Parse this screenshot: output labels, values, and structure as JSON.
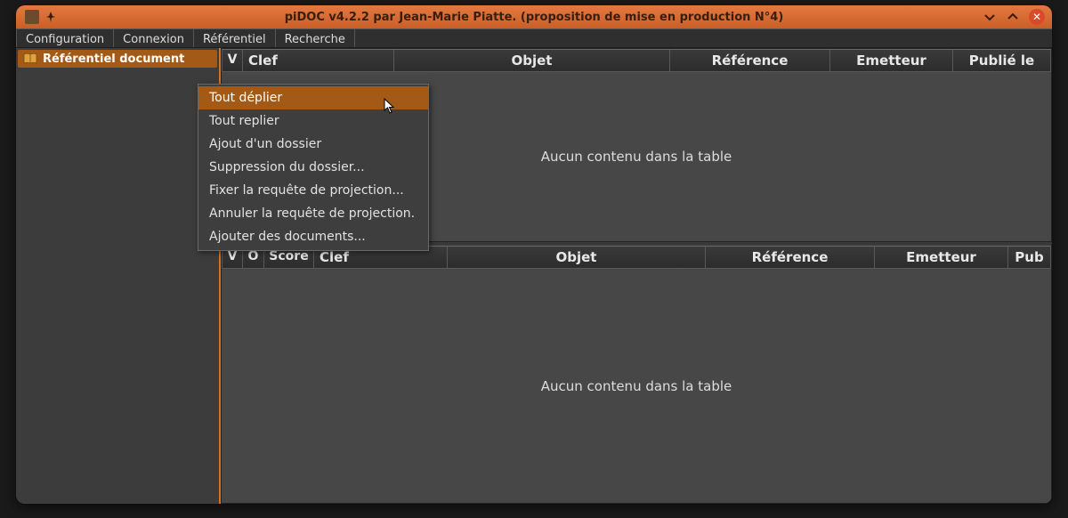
{
  "window": {
    "title": "piDOC v4.2.2 par Jean-Marie Piatte. (proposition de mise en production N°4)"
  },
  "menubar": {
    "items": [
      "Configuration",
      "Connexion",
      "Référentiel",
      "Recherche"
    ]
  },
  "sidebar": {
    "tree_label": "Référentiel document"
  },
  "context_menu": {
    "items": [
      "Tout déplier",
      "Tout replier",
      "Ajout d'un dossier",
      "Suppression du dossier...",
      "Fixer la requête de projection...",
      "Annuler la requête de projection.",
      "Ajouter des documents..."
    ],
    "selected_index": 0
  },
  "table_top": {
    "headers": {
      "v": "V",
      "clef": "Clef",
      "objet": "Objet",
      "ref": "Référence",
      "emit": "Emetteur",
      "pub": "Publié le"
    },
    "empty_text": "Aucun contenu dans la table"
  },
  "table_bottom": {
    "headers": {
      "v": "V",
      "o": "O",
      "score": "Score",
      "clef": "Clef",
      "objet": "Objet",
      "ref": "Référence",
      "emit": "Emetteur",
      "pub": "Pub"
    },
    "empty_text": "Aucun contenu dans la table"
  }
}
